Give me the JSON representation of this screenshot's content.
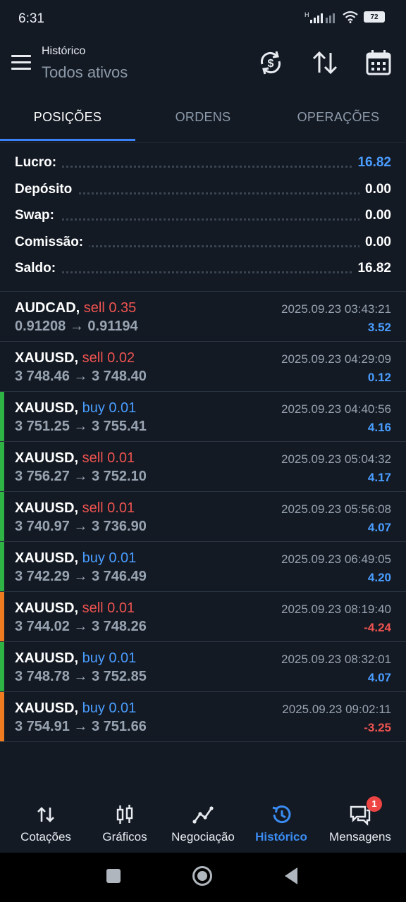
{
  "status_bar": {
    "time": "6:31",
    "battery": "72"
  },
  "header": {
    "title": "Histórico",
    "subtitle": "Todos ativos"
  },
  "tabs": [
    {
      "label": "POSIÇÕES"
    },
    {
      "label": "ORDENS"
    },
    {
      "label": "OPERAÇÕES"
    }
  ],
  "summary": [
    {
      "label": "Lucro:",
      "value": "16.82",
      "color": "#4a9dff"
    },
    {
      "label": "Depósito",
      "value": "0.00",
      "color": "#ffffff"
    },
    {
      "label": "Swap:",
      "value": "0.00",
      "color": "#ffffff"
    },
    {
      "label": "Comissão:",
      "value": "0.00",
      "color": "#ffffff"
    },
    {
      "label": "Saldo:",
      "value": "16.82",
      "color": "#ffffff"
    }
  ],
  "deals": [
    {
      "symbol": "AUDCAD,",
      "side": "sell 0.35",
      "side_type": "sell",
      "prices": "0.91208 → 0.91194",
      "time": "2025.09.23 03:43:21",
      "profit": "3.52",
      "profit_type": "pos",
      "bar": ""
    },
    {
      "symbol": "XAUUSD,",
      "side": "sell 0.02",
      "side_type": "sell",
      "prices": "3 748.46 → 3 748.40",
      "time": "2025.09.23 04:29:09",
      "profit": "0.12",
      "profit_type": "pos",
      "bar": ""
    },
    {
      "symbol": "XAUUSD,",
      "side": "buy 0.01",
      "side_type": "buy",
      "prices": "3 751.25 → 3 755.41",
      "time": "2025.09.23 04:40:56",
      "profit": "4.16",
      "profit_type": "pos",
      "bar": "#2fb344"
    },
    {
      "symbol": "XAUUSD,",
      "side": "sell 0.01",
      "side_type": "sell",
      "prices": "3 756.27 → 3 752.10",
      "time": "2025.09.23 05:04:32",
      "profit": "4.17",
      "profit_type": "pos",
      "bar": "#2fb344"
    },
    {
      "symbol": "XAUUSD,",
      "side": "sell 0.01",
      "side_type": "sell",
      "prices": "3 740.97 → 3 736.90",
      "time": "2025.09.23 05:56:08",
      "profit": "4.07",
      "profit_type": "pos",
      "bar": "#2fb344"
    },
    {
      "symbol": "XAUUSD,",
      "side": "buy 0.01",
      "side_type": "buy",
      "prices": "3 742.29 → 3 746.49",
      "time": "2025.09.23 06:49:05",
      "profit": "4.20",
      "profit_type": "pos",
      "bar": "#2fb344"
    },
    {
      "symbol": "XAUUSD,",
      "side": "sell 0.01",
      "side_type": "sell",
      "prices": "3 744.02 → 3 748.26",
      "time": "2025.09.23 08:19:40",
      "profit": "-4.24",
      "profit_type": "neg",
      "bar": "#f07c22"
    },
    {
      "symbol": "XAUUSD,",
      "side": "buy 0.01",
      "side_type": "buy",
      "prices": "3 748.78 → 3 752.85",
      "time": "2025.09.23 08:32:01",
      "profit": "4.07",
      "profit_type": "pos",
      "bar": "#2fb344"
    },
    {
      "symbol": "XAUUSD,",
      "side": "buy 0.01",
      "side_type": "buy",
      "prices": "3 754.91 → 3 751.66",
      "time": "2025.09.23 09:02:11",
      "profit": "-3.25",
      "profit_type": "neg",
      "bar": "#f07c22"
    }
  ],
  "bottom_nav": [
    {
      "label": "Cotações",
      "icon": "quotes-icon"
    },
    {
      "label": "Gráficos",
      "icon": "charts-icon"
    },
    {
      "label": "Negociação",
      "icon": "trade-icon"
    },
    {
      "label": "Histórico",
      "icon": "history-icon",
      "active": true
    },
    {
      "label": "Mensagens",
      "icon": "messages-icon",
      "badge": "1"
    }
  ]
}
